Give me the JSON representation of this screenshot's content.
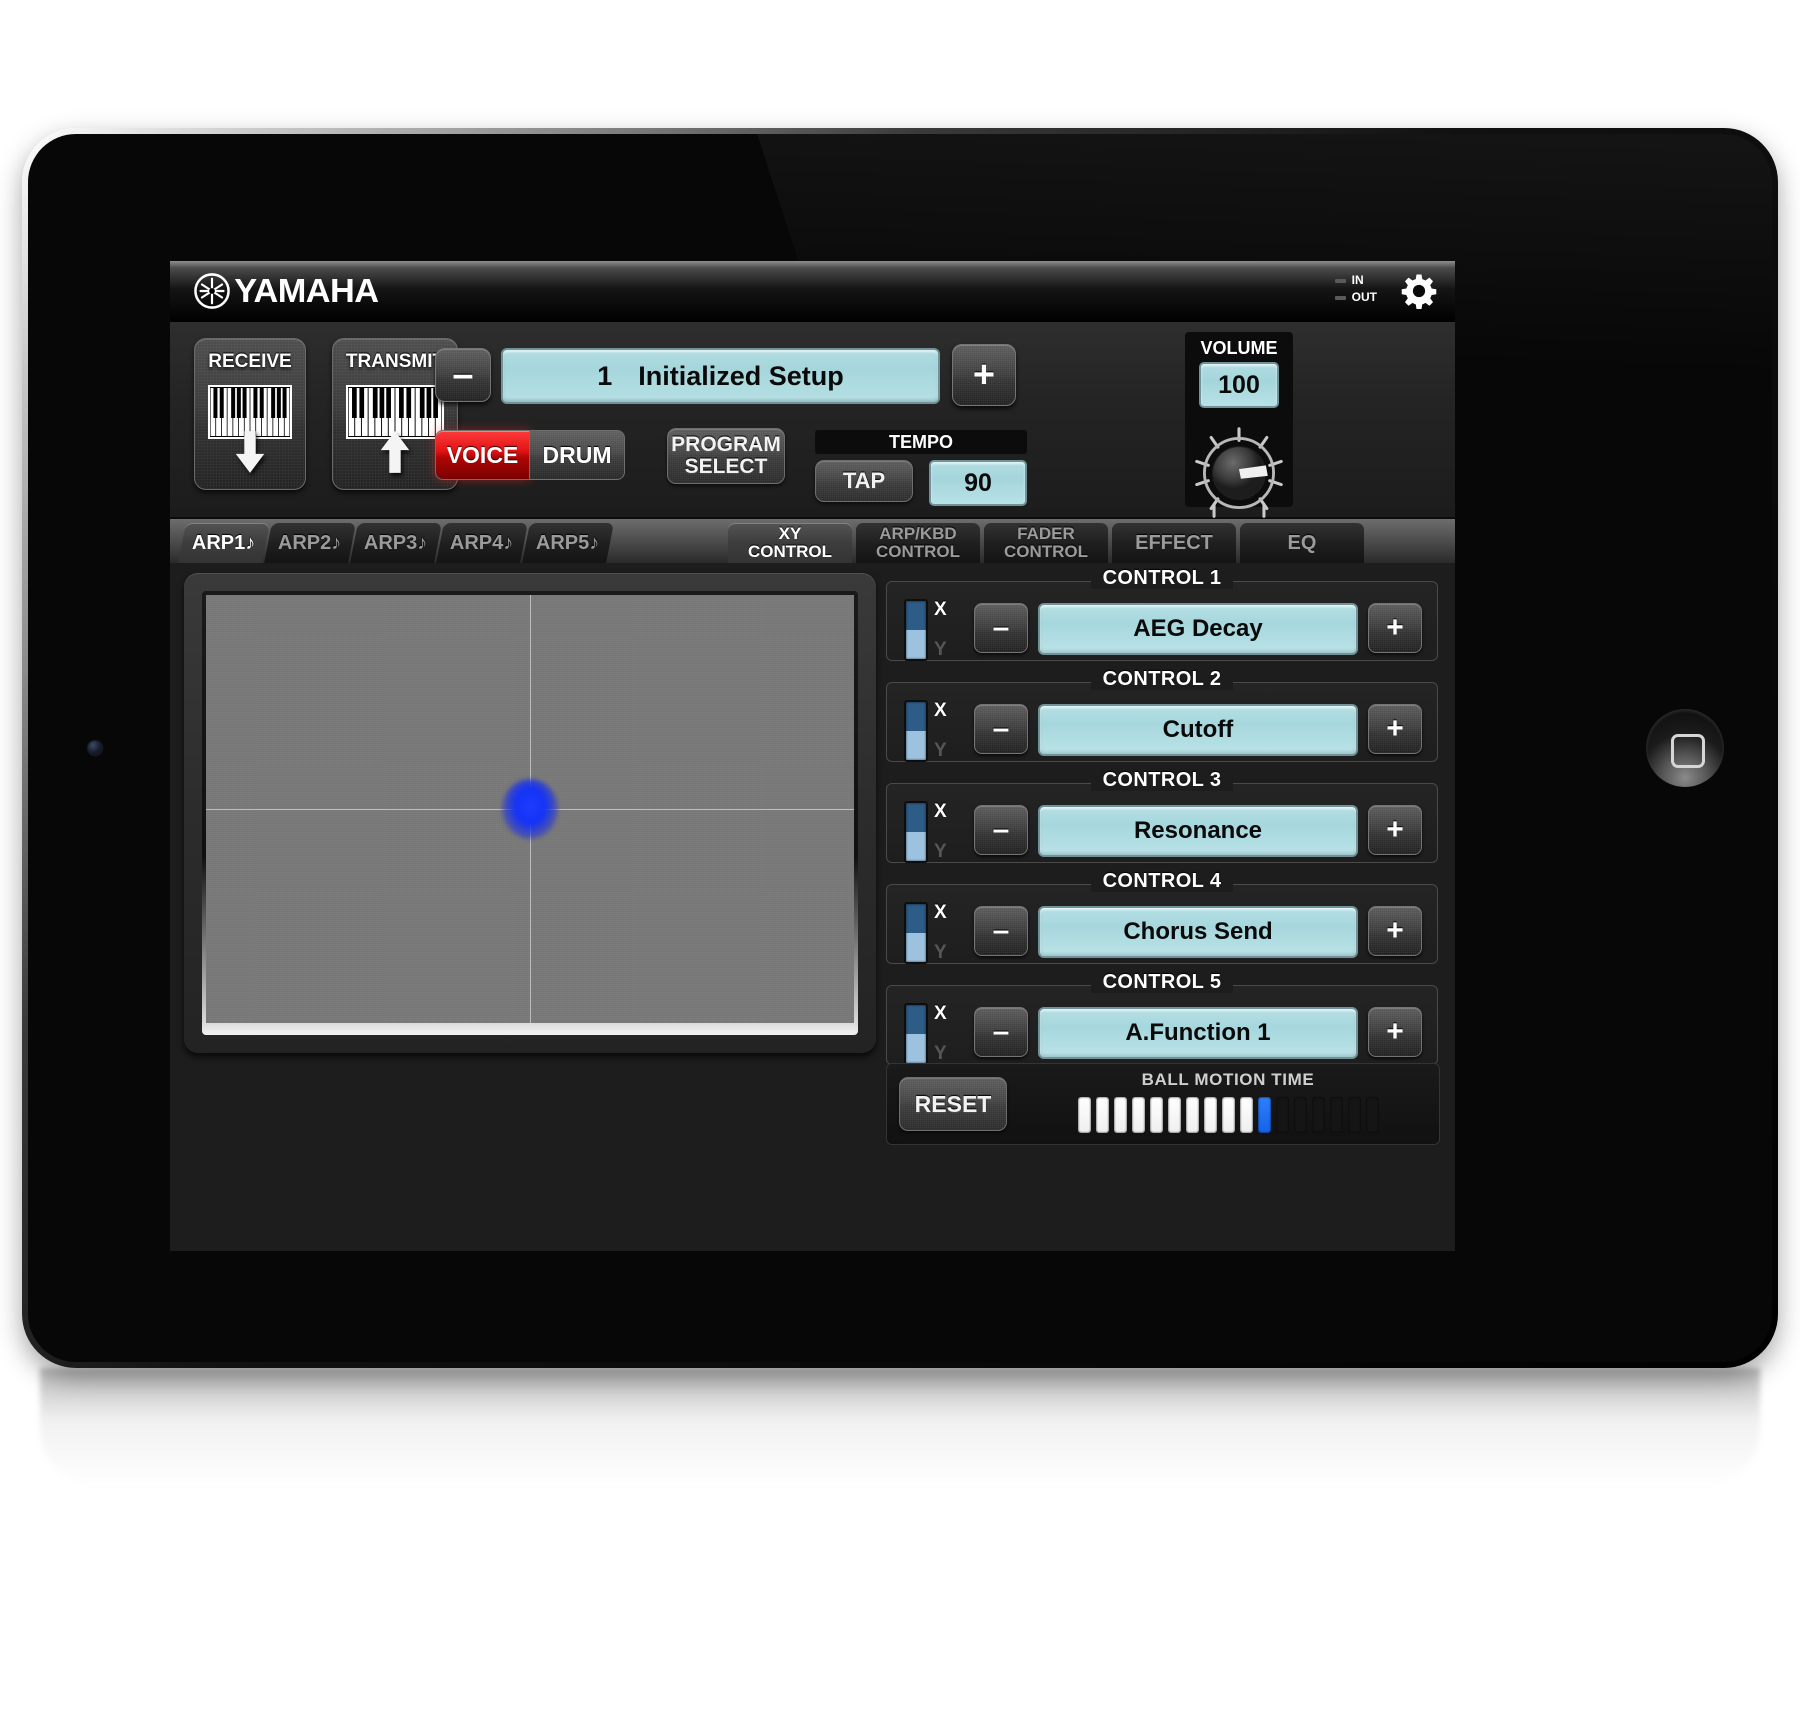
{
  "app": {
    "brand": "YAMAHA",
    "io": {
      "in_label": "IN",
      "out_label": "OUT"
    },
    "gear_icon": "gear-icon"
  },
  "top": {
    "receive_label": "RECEIVE",
    "transmit_label": "TRANSMIT",
    "receive_arrow": "arrow-down-icon",
    "transmit_arrow": "arrow-up-icon",
    "prog_minus": "–",
    "prog_plus": "+",
    "program_number": "1",
    "program_name": "Initialized Setup",
    "voice_label": "VOICE",
    "drum_label": "DRUM",
    "voice_active": true,
    "program_select_line1": "PROGRAM",
    "program_select_line2": "SELECT",
    "tempo_label": "TEMPO",
    "tap_label": "TAP",
    "tempo_value": "90",
    "volume_label": "VOLUME",
    "volume_value": "100",
    "accent_lcd": "#aed8de",
    "accent_red": "#e01414"
  },
  "tabs": {
    "arp": [
      {
        "label": "ARP1♪",
        "active": true
      },
      {
        "label": "ARP2♪",
        "active": false
      },
      {
        "label": "ARP3♪",
        "active": false
      },
      {
        "label": "ARP4♪",
        "active": false
      },
      {
        "label": "ARP5♪",
        "active": false
      }
    ],
    "modes": [
      {
        "l1": "XY",
        "l2": "CONTROL",
        "active": true
      },
      {
        "l1": "ARP/KBD",
        "l2": "CONTROL",
        "active": false
      },
      {
        "l1": "FADER",
        "l2": "CONTROL",
        "active": false
      },
      {
        "l1": "EFFECT",
        "l2": "",
        "active": false
      },
      {
        "l1": "EQ",
        "l2": "",
        "active": false
      }
    ]
  },
  "xypad": {
    "ball_x_pct": 50,
    "ball_y_pct": 50,
    "crosshair_x_pct": 50,
    "crosshair_y_pct": 50,
    "ball_color": "#1433f5"
  },
  "controls": [
    {
      "title": "CONTROL 1",
      "value": "AEG Decay",
      "axis": "X",
      "y_label": "Y",
      "minus": "–",
      "plus": "+"
    },
    {
      "title": "CONTROL 2",
      "value": "Cutoff",
      "axis": "X",
      "y_label": "Y",
      "minus": "–",
      "plus": "+"
    },
    {
      "title": "CONTROL 3",
      "value": "Resonance",
      "axis": "X",
      "y_label": "Y",
      "minus": "–",
      "plus": "+"
    },
    {
      "title": "CONTROL 4",
      "value": "Chorus Send",
      "axis": "X",
      "y_label": "Y",
      "minus": "–",
      "plus": "+"
    },
    {
      "title": "CONTROL 5",
      "value": "A.Function 1",
      "axis": "X",
      "y_label": "Y",
      "minus": "–",
      "plus": "+"
    }
  ],
  "bottom": {
    "reset_label": "RESET",
    "ball_motion_label": "BALL MOTION TIME",
    "ball_motion_total": 17,
    "ball_motion_filled": 10,
    "ball_motion_current_index": 10,
    "bar_on_color": "#ffffff",
    "bar_current_color": "#1463e8",
    "bar_off_color": "#151515"
  }
}
